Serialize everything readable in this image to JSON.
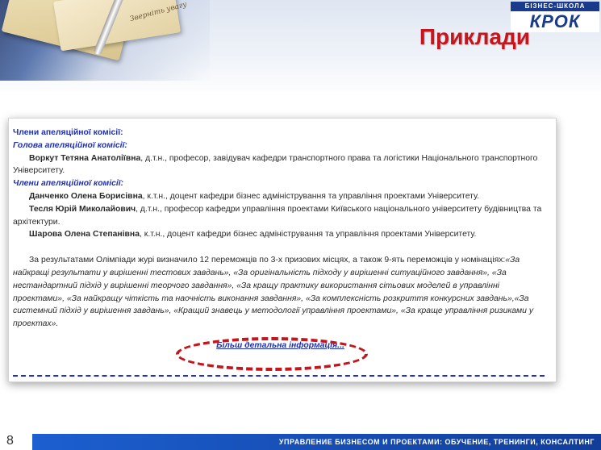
{
  "header": {
    "title": "Приклади",
    "logo_top": "БІЗНЕС-ШКОЛА",
    "logo_main": "КРОК",
    "scribble": "Зверніть увагу"
  },
  "doc": {
    "commission_heading": "Члени апеляційної комісії:",
    "chair_heading": "Голова апеляційної комісії:",
    "chair_name": "Воркут Тетяна Анатоліївна",
    "chair_desc": ", д.т.н., професор, завідувач кафедри транспортного права та логістики Національного транспортного Університету.",
    "members_heading": "Члени апеляційної комісії:",
    "members": [
      {
        "name": "Данченко Олена Борисівна",
        "desc": ", к.т.н., доцент кафедри бізнес адміністрування та управління проектами Університету."
      },
      {
        "name": "Тесля Юрій Миколайович",
        "desc": ", д.т.н., професор кафедри управління проектами Київського національного університету будівництва та архітектури."
      },
      {
        "name": "Шарова Олена Степанівна",
        "desc": ", к.т.н., доцент кафедри бізнес адміністрування та управління проектами Університету."
      }
    ],
    "results_intro": "За результатами Олімпіади журі визначило 12 переможців по 3-х призових місцях, а також 9-ять переможців у номінаціях:",
    "nominations": "«За найкращі результати у вирішенні тестових завдань», «За оригінальність підходу у вирішенні ситуаційного завдання», «За нестандартний підхід у вирішенні теорчого завдання», «За кращу практику використання сітьових моделей в управлінні проектами», «За найкращу чіткість та наочність виконання завдання», «За комплексність розкриття конкурсних завдань»,«За системний підхід у вирішення завдань», «Кращий знавець у методології управління проектами», «За краще управління ризиками у проектах».",
    "link": "Більш детальна інформація..."
  },
  "footer": {
    "page_number": "8",
    "tagline": "УПРАВЛЕНИЕ БИЗНЕСОМ И ПРОЕКТАМИ: ОБУЧЕНИЕ, ТРЕНИНГИ, КОНСАЛТИНГ"
  },
  "colors": {
    "title_red": "#c4161c",
    "link_blue": "#1e2fb6",
    "footer_blue": "#1c5fd0"
  }
}
